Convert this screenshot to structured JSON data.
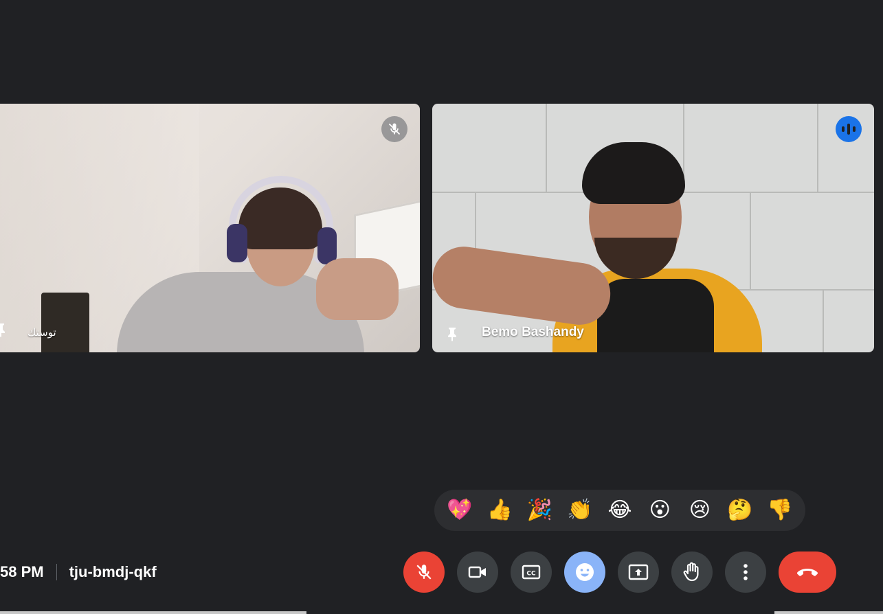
{
  "participants": [
    {
      "name": "توستك",
      "pinned": true,
      "muted": true
    },
    {
      "name": "Bemo Bashandy",
      "pinned": true,
      "speaking": true
    }
  ],
  "reactions": [
    "💖",
    "👍",
    "🎉",
    "👏",
    "😂",
    "😮",
    "😢",
    "🤔",
    "👎"
  ],
  "meeting": {
    "time": "58 PM",
    "code": "tju-bmdj-qkf"
  },
  "controls": {
    "mic": "mic-off-icon",
    "camera": "videocam-icon",
    "captions": "closed-captions-icon",
    "emoji": "emoji-icon",
    "present": "present-screen-icon",
    "raise_hand": "raise-hand-icon",
    "more": "more-vert-icon",
    "leave": "call-end-icon"
  },
  "colors": {
    "background": "#202124",
    "danger": "#ea4335",
    "accent": "#8ab4f8",
    "speaking": "#1a73e8"
  }
}
